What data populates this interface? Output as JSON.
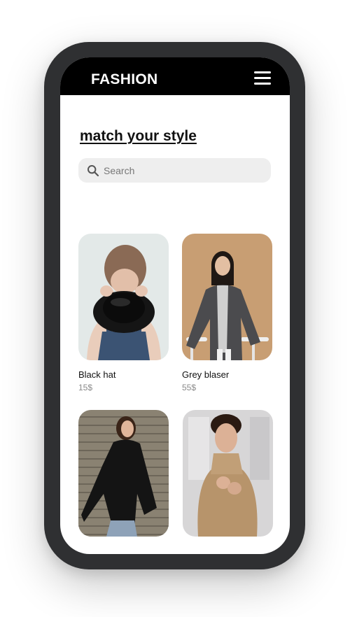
{
  "header": {
    "brand": "FASHION",
    "menu_icon": "hamburger-menu-icon"
  },
  "main": {
    "headline": "match your style",
    "search": {
      "placeholder": "Search",
      "value": "",
      "icon": "search-icon"
    },
    "products": [
      {
        "name": "Black hat",
        "price": "15$"
      },
      {
        "name": "Grey blaser",
        "price": "55$"
      },
      {
        "name": "",
        "price": ""
      },
      {
        "name": "",
        "price": ""
      }
    ]
  },
  "colors": {
    "header_bg": "#000000",
    "phone_frame": "#2f3032",
    "search_bg": "#eeeeee",
    "price_text": "#8a8a8a"
  }
}
